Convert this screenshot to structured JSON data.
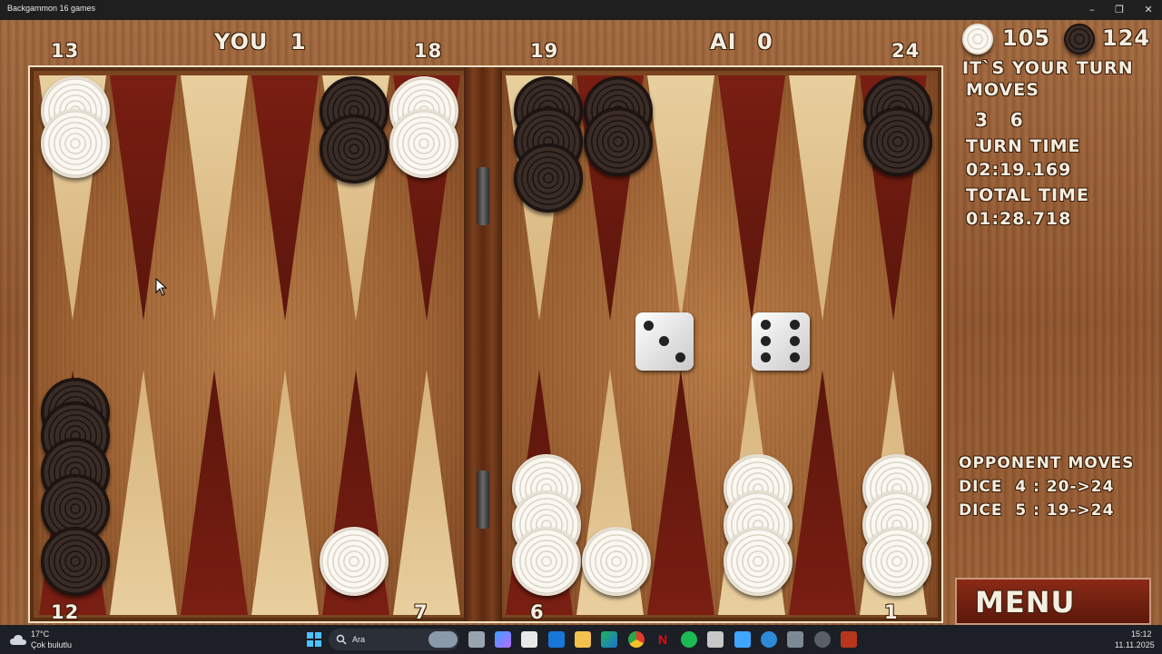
{
  "window": {
    "title": "Backgammon 16 games",
    "min": "–",
    "max": "❐",
    "close": "✕"
  },
  "hud": {
    "you_label": "YOU",
    "you_score": "1",
    "ai_label": "AI",
    "ai_score": "0",
    "point_labels_top": [
      "13",
      "18",
      "19",
      "24"
    ],
    "point_labels_bottom": [
      "12",
      "7",
      "6",
      "1"
    ]
  },
  "panel": {
    "white_pips": "105",
    "black_pips": "124",
    "turn_msg": "IT`S YOUR TURN",
    "moves_label": "MOVES",
    "move_values": "3   6",
    "turn_time_label": "TURN TIME",
    "turn_time": "02:19.169",
    "total_time_label": "TOTAL TIME",
    "total_time": "01:28.718",
    "opponent_label": "OPPONENT MOVES",
    "opp_move_1": "DICE  4 : 20->24",
    "opp_move_2": "DICE  5 : 19->24",
    "menu": "MENU"
  },
  "dice": [
    3,
    6
  ],
  "colors": {
    "white_checker": "#efeae0",
    "black_checker": "#2a1f1b",
    "dark_point": "#6a1a10",
    "light_point": "#dfc08a"
  },
  "taskbar": {
    "weather_temp": "17°C",
    "weather_desc": "Çok bulutlu",
    "search": "Ara",
    "time": "15:12",
    "date": "11.11.2025"
  }
}
